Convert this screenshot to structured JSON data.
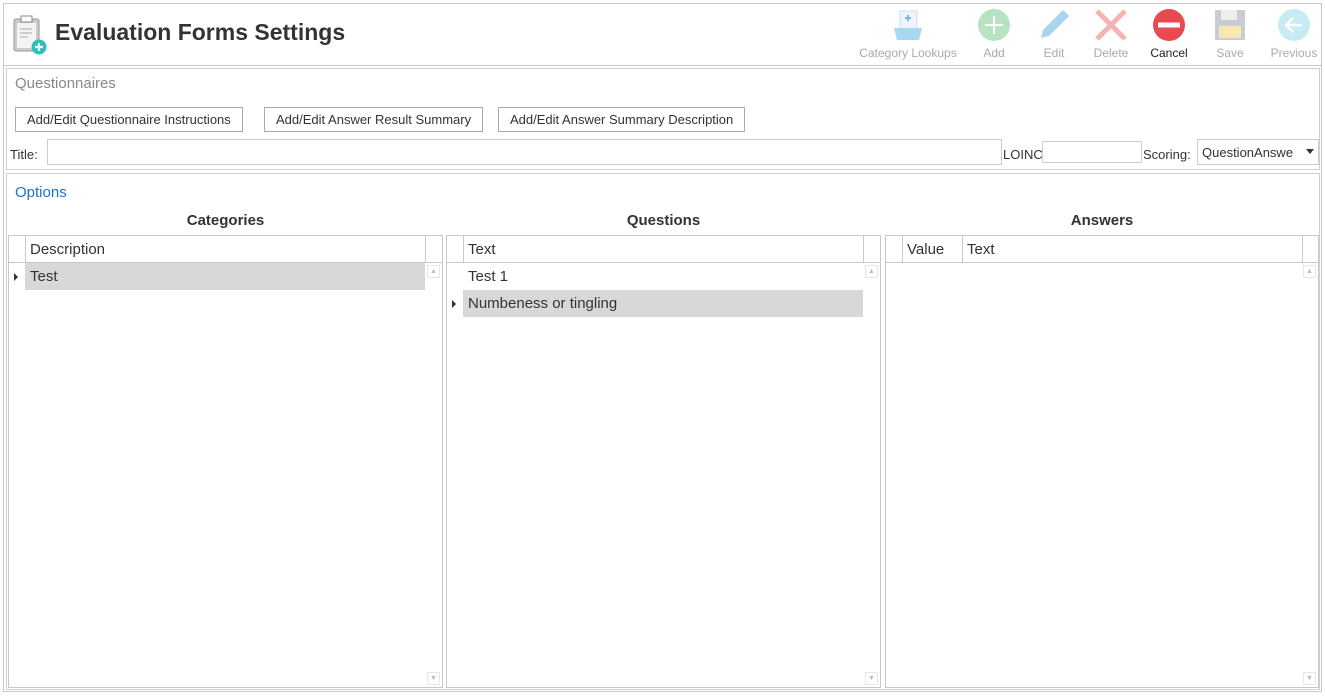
{
  "header": {
    "title": "Evaluation Forms Settings",
    "toolbar": [
      {
        "id": "category-lookups",
        "label": "Category Lookups",
        "enabled": false
      },
      {
        "id": "add",
        "label": "Add",
        "enabled": false
      },
      {
        "id": "edit",
        "label": "Edit",
        "enabled": false
      },
      {
        "id": "delete",
        "label": "Delete",
        "enabled": false
      },
      {
        "id": "cancel",
        "label": "Cancel",
        "enabled": true
      },
      {
        "id": "save",
        "label": "Save",
        "enabled": false
      },
      {
        "id": "previous",
        "label": "Previous",
        "enabled": false
      }
    ]
  },
  "questionnaires": {
    "title": "Questionnaires",
    "buttons": [
      "Add/Edit Questionnaire Instructions",
      "Add/Edit Answer Result Summary",
      "Add/Edit Answer Summary Description"
    ],
    "title_label": "Title:",
    "title_value": "",
    "loinc_label": "LOINC",
    "loinc_value": "",
    "scoring_label": "Scoring:",
    "scoring_value": "QuestionAnswe"
  },
  "options": {
    "title": "Options",
    "categories": {
      "title": "Categories",
      "columns": [
        "Description"
      ],
      "rows": [
        "Test"
      ]
    },
    "questions": {
      "title": "Questions",
      "columns": [
        "Text"
      ],
      "rows": [
        "Test 1",
        "Numbeness or tingling"
      ]
    },
    "answers": {
      "title": "Answers",
      "columns": [
        "Value",
        "Text"
      ],
      "rows": []
    }
  },
  "colors": {
    "accent": "#1a73c8",
    "cancel": "#e84a4f",
    "selected_row": "#d8d8d8"
  }
}
